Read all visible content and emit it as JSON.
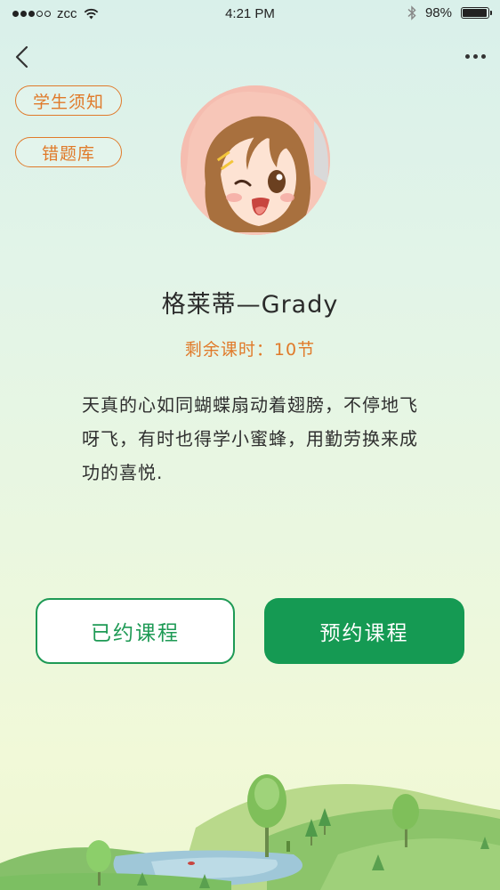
{
  "status_bar": {
    "carrier": "zcc",
    "time": "4:21 PM",
    "battery_percent": "98%",
    "battery_level": 0.98
  },
  "nav": {
    "back_icon": "chevron-left-icon",
    "more_icon": "more-dots-icon"
  },
  "side_links": {
    "notice": "学生须知",
    "wrong_questions": "错题库"
  },
  "profile": {
    "name": "格莱蒂—Grady",
    "remaining": "剩余课时：10节",
    "bio": "天真的心如同蝴蝶扇动着翅膀，不停地飞呀飞，有时也得学小蜜蜂，用勤劳换来成功的喜悦."
  },
  "actions": {
    "booked_label": "已约课程",
    "book_label": "预约课程"
  },
  "colors": {
    "accent_orange": "#e07a2a",
    "primary_green": "#159a53"
  }
}
